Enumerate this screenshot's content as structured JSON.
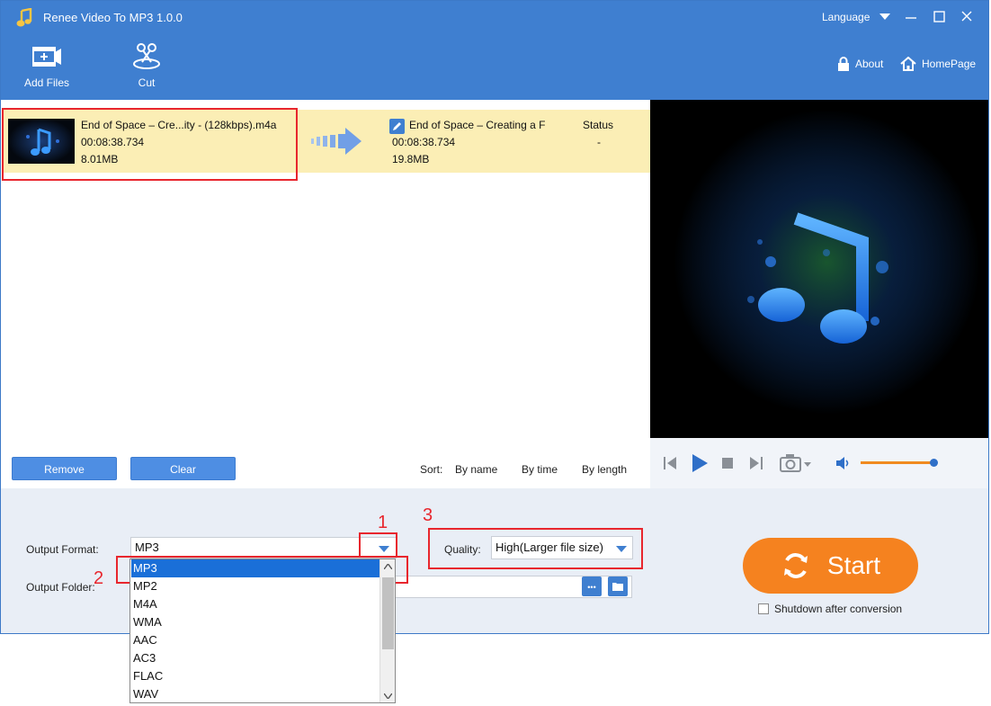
{
  "app": {
    "title": "Renee Video To MP3 1.0.0",
    "language_label": "Language"
  },
  "toolbar": {
    "add_files": "Add Files",
    "cut": "Cut",
    "about": "About",
    "homepage": "HomePage"
  },
  "file": {
    "src_name": "End of Space – Cre...ity - (128kbps).m4a",
    "src_duration": "00:08:38.734",
    "src_size": "8.01MB",
    "out_name": "End of Space – Creating a F",
    "out_duration": "00:08:38.734",
    "out_size": "19.8MB",
    "status_header": "Status",
    "status_value": "-"
  },
  "list_actions": {
    "remove": "Remove",
    "clear": "Clear"
  },
  "sort": {
    "label": "Sort:",
    "by_name": "By name",
    "by_time": "By time",
    "by_length": "By length"
  },
  "player": {
    "volume_level": 0.95
  },
  "output": {
    "format_label": "Output Format:",
    "format_value": "MP3",
    "folder_label": "Output Folder:",
    "folder_browse": "•••",
    "quality_label": "Quality:",
    "quality_value": "High(Larger file size)"
  },
  "format_options": [
    "MP3",
    "MP2",
    "M4A",
    "WMA",
    "AAC",
    "AC3",
    "FLAC",
    "WAV"
  ],
  "start": {
    "label": "Start",
    "shutdown_label": "Shutdown after conversion"
  },
  "annotations": {
    "one": "1",
    "two": "2",
    "three": "3"
  },
  "colors": {
    "header": "#3f7fd0",
    "start": "#f5821f",
    "selected_row": "#fbeeb5",
    "annotation": "#e8262d"
  }
}
